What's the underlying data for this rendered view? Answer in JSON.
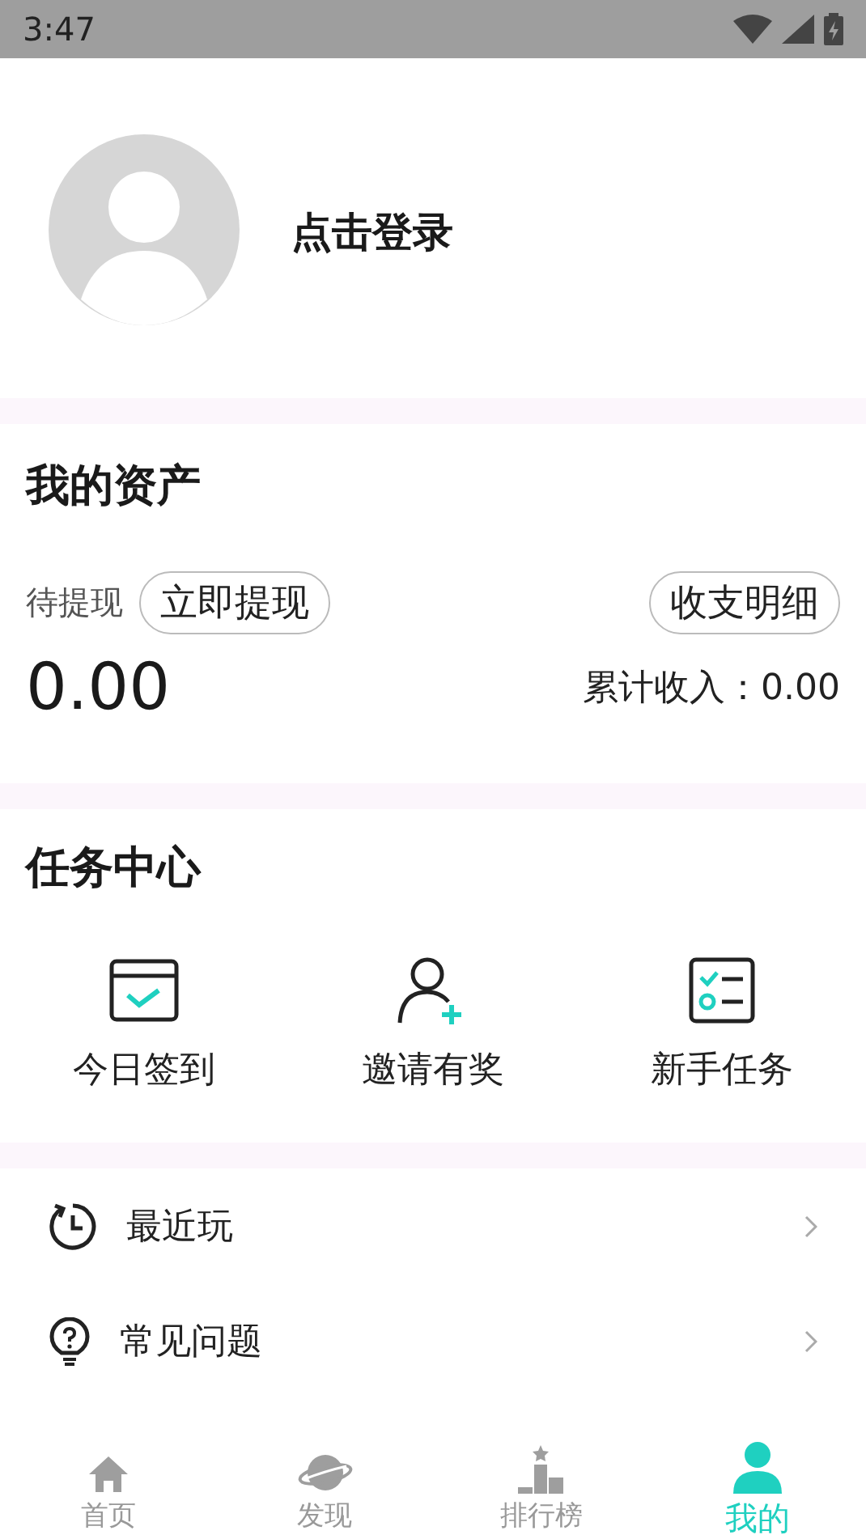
{
  "status_bar": {
    "time": "3:47"
  },
  "profile": {
    "login_text": "点击登录"
  },
  "assets": {
    "title": "我的资产",
    "pending_label": "待提现",
    "withdraw_button": "立即提现",
    "details_button": "收支明细",
    "balance": "0.00",
    "total_income": "累计收入：0.00"
  },
  "tasks": {
    "title": "任务中心",
    "items": [
      {
        "kind": "checkin",
        "label": "今日签到"
      },
      {
        "kind": "invite",
        "label": "邀请有奖"
      },
      {
        "kind": "newbie",
        "label": "新手任务"
      }
    ]
  },
  "menu": [
    {
      "kind": "history",
      "label": "最近玩"
    },
    {
      "kind": "help",
      "label": "常见问题"
    }
  ],
  "bottom_nav": [
    {
      "kind": "home",
      "label": "首页",
      "selected": false
    },
    {
      "kind": "discover",
      "label": "发现",
      "selected": false
    },
    {
      "kind": "ranking",
      "label": "排行榜",
      "selected": false
    },
    {
      "kind": "mine",
      "label": "我的",
      "selected": true
    }
  ]
}
